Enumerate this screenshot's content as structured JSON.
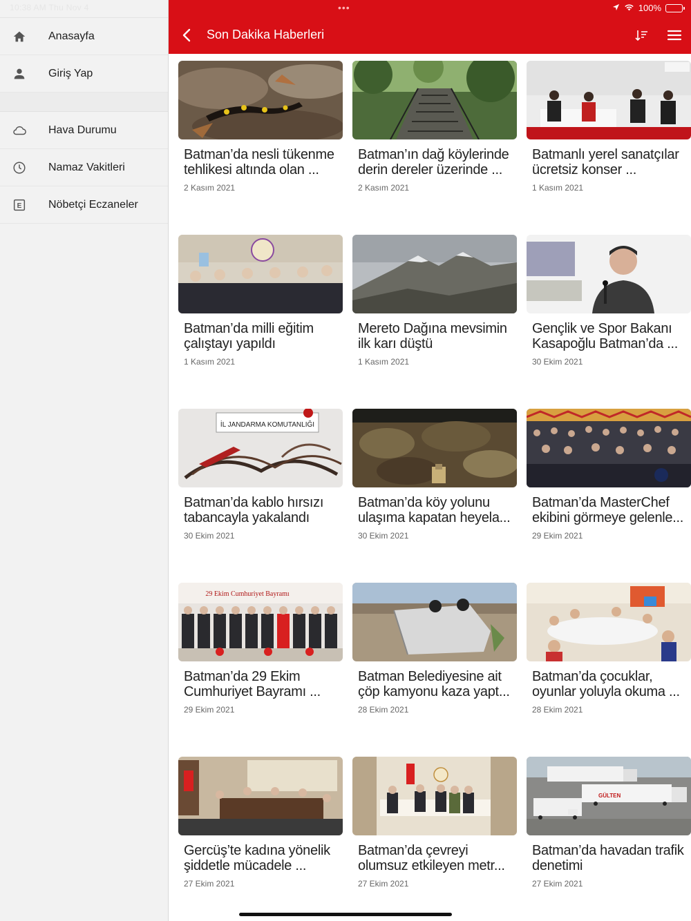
{
  "status": {
    "time_date": "10:38 AM   Thu Nov 4",
    "battery": "100%"
  },
  "sidebar": {
    "items": [
      {
        "label": "Anasayfa",
        "icon": "home-icon"
      },
      {
        "label": "Giriş Yap",
        "icon": "person-icon"
      },
      {
        "label": "Hava Durumu",
        "icon": "cloud-icon"
      },
      {
        "label": "Namaz Vakitleri",
        "icon": "clock-icon"
      },
      {
        "label": "Nöbetçi Eczaneler",
        "icon": "pharmacy-icon"
      }
    ]
  },
  "header": {
    "title": "Son Dakika Haberleri",
    "accent": "#d80f16"
  },
  "news": [
    {
      "title": "Batman’da nesli tükenme tehlikesi altında olan ...",
      "date": "2 Kasım 2021",
      "image": "salamander-photo"
    },
    {
      "title": "Batman’ın dağ köylerinde derin dereler üzerinde ...",
      "date": "2 Kasım 2021",
      "image": "bridge-photo"
    },
    {
      "title": "Batmanlı yerel sanatçılar ücretsiz konser ...",
      "date": "1 Kasım 2021",
      "image": "artists-photo"
    },
    {
      "title": "Batman’da milli eğitim çalıştayı yapıldı",
      "date": "1 Kasım 2021",
      "image": "education-meeting-photo"
    },
    {
      "title": "Mereto Dağına mevsimin ilk karı düştü",
      "date": "1 Kasım 2021",
      "image": "snowy-mountain-photo"
    },
    {
      "title": "Gençlik ve Spor Bakanı Kasapoğlu Batman’da ...",
      "date": "30 Ekim 2021",
      "image": "minister-speech-photo"
    },
    {
      "title": "Batman’da kablo hırsızı tabancayla yakalandı",
      "date": "30 Ekim 2021",
      "image": "seized-cables-photo"
    },
    {
      "title": "Batman’da köy yolunu ulaşıma kapatan heyela...",
      "date": "30 Ekim 2021",
      "image": "landslide-photo"
    },
    {
      "title": "Batman’da MasterChef ekibini görmeye gelenle...",
      "date": "29 Ekim 2021",
      "image": "crowd-photo"
    },
    {
      "title": "Batman’da 29 Ekim Cumhuriyet Bayramı ...",
      "date": "29 Ekim 2021",
      "image": "ceremony-photo"
    },
    {
      "title": "Batman Belediyesine ait çöp kamyonu kaza yapt...",
      "date": "28 Ekim 2021",
      "image": "overturned-truck-photo"
    },
    {
      "title": "Batman’da çocuklar, oyunlar yoluyla okuma ...",
      "date": "28 Ekim 2021",
      "image": "classroom-photo"
    },
    {
      "title": "Gercüş’te kadına yönelik şiddetle mücadele ...",
      "date": "27 Ekim 2021",
      "image": "office-meeting-photo"
    },
    {
      "title": "Batman’da çevreyi olumsuz etkileyen metr...",
      "date": "27 Ekim 2021",
      "image": "officials-meeting-photo"
    },
    {
      "title": "Batman’da havadan trafik denetimi",
      "date": "27 Ekim 2021",
      "image": "trucks-highway-photo"
    }
  ]
}
